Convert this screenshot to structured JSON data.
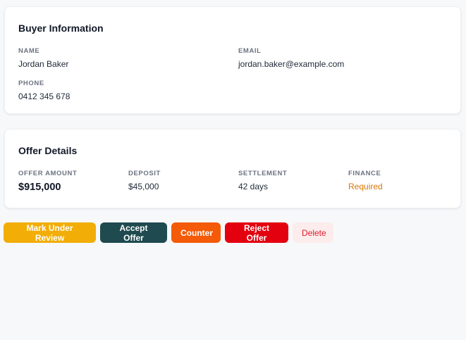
{
  "buyer": {
    "title": "Buyer Information",
    "name_label": "NAME",
    "name_value": "Jordan Baker",
    "email_label": "EMAIL",
    "email_value": "jordan.baker@example.com",
    "phone_label": "PHONE",
    "phone_value": "0412 345 678"
  },
  "offer": {
    "title": "Offer Details",
    "amount_label": "OFFER AMOUNT",
    "amount_value": "$915,000",
    "deposit_label": "DEPOSIT",
    "deposit_value": "$45,000",
    "settlement_label": "SETTLEMENT",
    "settlement_value": "42 days",
    "finance_label": "FINANCE",
    "finance_value": "Required"
  },
  "actions": {
    "review": "Mark Under Review",
    "accept": "Accept Offer",
    "counter": "Counter",
    "reject": "Reject Offer",
    "delete": "Delete"
  },
  "colors": {
    "review": "#f2ad06",
    "accept": "#1f4a4f",
    "counter": "#f45a07",
    "reject": "#e3000f",
    "delete_bg": "#fdecec",
    "finance_required": "#d97706"
  }
}
